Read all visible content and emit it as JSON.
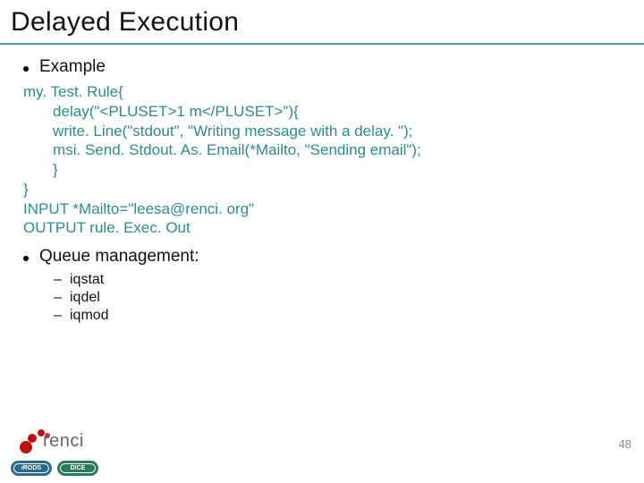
{
  "title": "Delayed Execution",
  "bullets": {
    "example": "Example",
    "queue": "Queue management:"
  },
  "code": {
    "l1": "my. Test. Rule{",
    "l2": "       delay(\"<PLUSET>1 m</PLUSET>\"){",
    "l3": "       write. Line(\"stdout\", \"Writing message with a delay. \");",
    "l4": "       msi. Send. Stdout. As. Email(*Mailto, \"Sending email\");",
    "l5": "       }",
    "l6": "}",
    "l7": "INPUT *Mailto=\"leesa@renci. org\"",
    "l8": "OUTPUT rule. Exec. Out"
  },
  "sub": {
    "s1": "iqstat",
    "s2": "iqdel",
    "s3": "iqmod"
  },
  "footer": {
    "page": "48",
    "logo_text": "renci",
    "badge1": "iRODS",
    "badge2": "DICE"
  }
}
